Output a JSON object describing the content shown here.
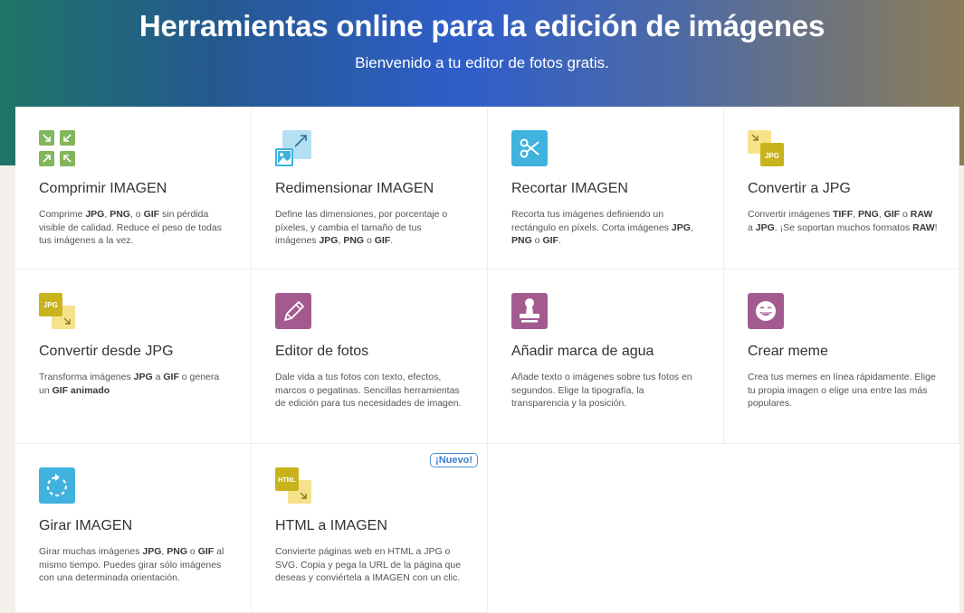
{
  "hero": {
    "title": "Herramientas online para la edición de imágenes",
    "subtitle": "Bienvenido a tu editor de fotos gratis."
  },
  "tools": [
    {
      "title": "Comprimir IMAGEN",
      "icon": "compress-icon",
      "desc": [
        [
          "Comprime ",
          0
        ],
        [
          "JPG",
          1
        ],
        [
          ", ",
          0
        ],
        [
          "PNG",
          1
        ],
        [
          ", o ",
          0
        ],
        [
          "GIF",
          1
        ],
        [
          " sin pérdida visible de calidad. Reduce el peso de todas tus imágenes a la vez.",
          0
        ]
      ]
    },
    {
      "title": "Redimensionar IMAGEN",
      "icon": "resize-icon",
      "desc": [
        [
          "Define las dimensiones, por porcentaje o píxeles, y cambia el tamaño de tus imágenes ",
          0
        ],
        [
          "JPG",
          1
        ],
        [
          ", ",
          0
        ],
        [
          "PNG",
          1
        ],
        [
          " o ",
          0
        ],
        [
          "GIF",
          1
        ],
        [
          ".",
          0
        ]
      ]
    },
    {
      "title": "Recortar IMAGEN",
      "icon": "crop-icon",
      "desc": [
        [
          "Recorta tus imágenes definiendo un rectángulo en píxels. Corta imágenes ",
          0
        ],
        [
          "JPG",
          1
        ],
        [
          ", ",
          0
        ],
        [
          "PNG",
          1
        ],
        [
          " o ",
          0
        ],
        [
          "GIF",
          1
        ],
        [
          ".",
          0
        ]
      ]
    },
    {
      "title": "Convertir a JPG",
      "icon": "convert-to-jpg-icon",
      "desc": [
        [
          "Convertir imágenes ",
          0
        ],
        [
          "TIFF",
          1
        ],
        [
          ", ",
          0
        ],
        [
          "PNG",
          1
        ],
        [
          ", ",
          0
        ],
        [
          "GIF",
          1
        ],
        [
          " o ",
          0
        ],
        [
          "RAW",
          1
        ],
        [
          " a ",
          0
        ],
        [
          "JPG",
          1
        ],
        [
          ". ¡Se soportan muchos formatos ",
          0
        ],
        [
          "RAW",
          1
        ],
        [
          "!",
          0
        ]
      ]
    },
    {
      "title": "Convertir desde JPG",
      "icon": "convert-from-jpg-icon",
      "desc": [
        [
          "Transforma imágenes ",
          0
        ],
        [
          "JPG",
          1
        ],
        [
          " a ",
          0
        ],
        [
          "GIF",
          1
        ],
        [
          " o genera un ",
          0
        ],
        [
          "GIF animado",
          1
        ]
      ]
    },
    {
      "title": "Editor de fotos",
      "icon": "pencil-icon",
      "desc": [
        [
          "Dale vida a tus fotos con texto, efectos, marcos o pegatinas. Sencillas herramientas de edición para tus necesidades de imagen.",
          0
        ]
      ]
    },
    {
      "title": "Añadir marca de agua",
      "icon": "stamp-icon",
      "desc": [
        [
          "Añade texto o imágenes sobre tus fotos en segundos. Elige la tipografía, la transparencia y la posición.",
          0
        ]
      ]
    },
    {
      "title": "Crear meme",
      "icon": "meme-face-icon",
      "desc": [
        [
          "Crea tus memes en línea rápidamente. Elige tu propia imagen o elige una entre las más populares.",
          0
        ]
      ]
    },
    {
      "title": "Girar IMAGEN",
      "icon": "rotate-icon",
      "desc": [
        [
          "Girar muchas imágenes ",
          0
        ],
        [
          "JPG",
          1
        ],
        [
          ", ",
          0
        ],
        [
          "PNG",
          1
        ],
        [
          " o ",
          0
        ],
        [
          "GIF",
          1
        ],
        [
          " al mismo tiempo. Puedes girar sólo imágenes con una determinada orientación.",
          0
        ]
      ]
    },
    {
      "title": "HTML a IMAGEN",
      "icon": "html-to-image-icon",
      "badge": "¡Nuevo!",
      "desc": [
        [
          "Convierte páginas web en HTML a JPG o SVG. Copia y pega la URL de la página que deseas y conviértela a IMAGEN con un clic.",
          0
        ]
      ]
    }
  ],
  "icon_labels": {
    "jpg": "JPG",
    "html": "HTML"
  },
  "colors": {
    "green": "#82b65a",
    "light_blue": "#b5dff2",
    "blue": "#3fb2dd",
    "yellow": "#f6e28b",
    "olive": "#c9b31c",
    "purple": "#a35b8f",
    "badge_blue": "#3a7fd0"
  }
}
